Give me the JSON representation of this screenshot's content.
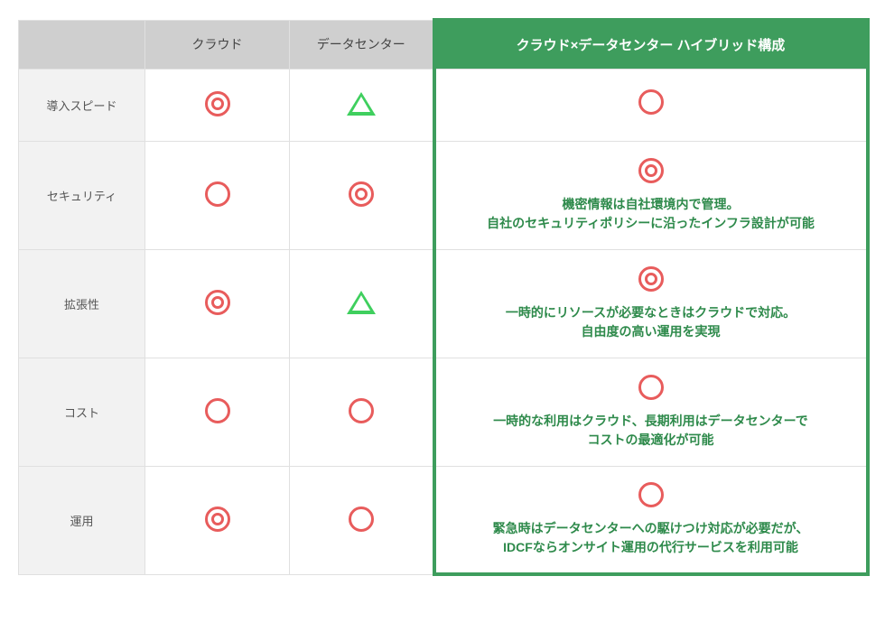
{
  "headers": {
    "blank": "",
    "cloud": "クラウド",
    "datacenter": "データセンター",
    "hybrid": "クラウド×データセンター ハイブリッド構成"
  },
  "rows": [
    {
      "label": "導入スピード",
      "cloud": "double",
      "datacenter": "triangle",
      "hybrid_icon": "single",
      "hybrid_desc": "",
      "tall": false
    },
    {
      "label": "セキュリティ",
      "cloud": "single",
      "datacenter": "double",
      "hybrid_icon": "double",
      "hybrid_desc": "機密情報は自社環境内で管理。\n自社のセキュリティポリシーに沿ったインフラ設計が可能",
      "tall": true
    },
    {
      "label": "拡張性",
      "cloud": "double",
      "datacenter": "triangle",
      "hybrid_icon": "double",
      "hybrid_desc": "一時的にリソースが必要なときはクラウドで対応。\n自由度の高い運用を実現",
      "tall": true
    },
    {
      "label": "コスト",
      "cloud": "single",
      "datacenter": "single",
      "hybrid_icon": "single",
      "hybrid_desc": "一時的な利用はクラウド、長期利用はデータセンターで\nコストの最適化が可能",
      "tall": true
    },
    {
      "label": "運用",
      "cloud": "double",
      "datacenter": "single",
      "hybrid_icon": "single",
      "hybrid_desc": "緊急時はデータセンターへの駆けつけ対応が必要だが、\nIDCFならオンサイト運用の代行サービスを利用可能",
      "tall": true
    }
  ]
}
